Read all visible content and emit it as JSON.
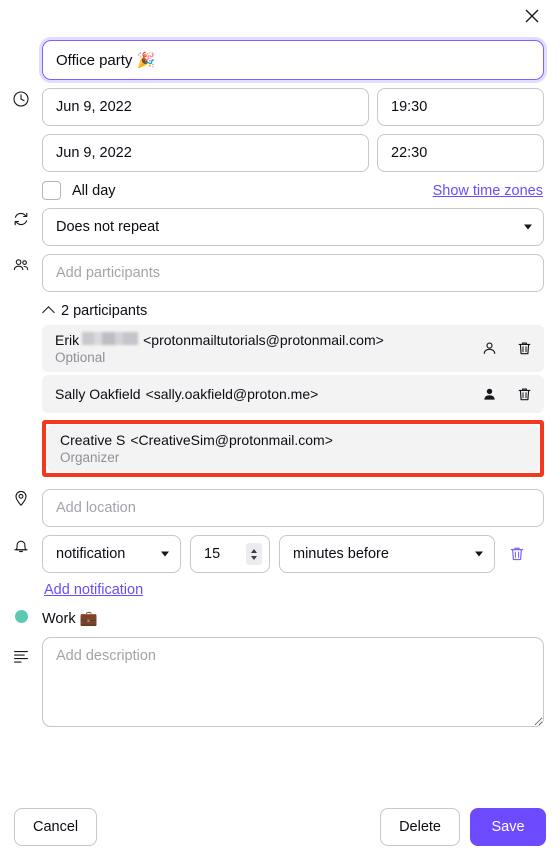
{
  "window": {
    "close_label": "Close"
  },
  "event": {
    "title": "Office party 🎉",
    "title_placeholder": "Add title"
  },
  "schedule": {
    "start_date": "Jun 9, 2022",
    "start_time": "19:30",
    "end_date": "Jun 9, 2022",
    "end_time": "22:30",
    "all_day_label": "All day",
    "all_day_checked": false,
    "time_zones_link": "Show time zones"
  },
  "recurrence": {
    "selected": "Does not repeat"
  },
  "participants": {
    "input_placeholder": "Add participants",
    "toggle_label": "2 participants",
    "count": 2,
    "rows": [
      {
        "name_prefix": "Erik",
        "name_redacted": true,
        "email": "<protonmailtutorials@protonmail.com>",
        "role": "Optional",
        "attendance_icon": "person-outline-icon",
        "delete_icon": "trash-icon",
        "highlighted": false
      },
      {
        "name_prefix": "Sally Oakfield",
        "name_redacted": false,
        "email": "<sally.oakfield@proton.me>",
        "role": "",
        "attendance_icon": "person-filled-icon",
        "delete_icon": "trash-icon",
        "highlighted": false
      },
      {
        "name_prefix": "Creative S",
        "name_redacted": false,
        "email": "<CreativeSim@protonmail.com>",
        "role": "Organizer",
        "attendance_icon": "",
        "delete_icon": "",
        "highlighted": true
      }
    ]
  },
  "location": {
    "placeholder": "Add location"
  },
  "notification": {
    "type": "notification",
    "amount": "15",
    "when": "minutes before",
    "add_label": "Add notification"
  },
  "calendar": {
    "name": "Work 💼",
    "color": "#5ec8b0"
  },
  "description": {
    "placeholder": "Add description",
    "value": ""
  },
  "footer": {
    "cancel": "Cancel",
    "delete": "Delete",
    "save": "Save"
  },
  "annotation": {
    "color": "#f4371f",
    "target": "organizer-row"
  }
}
